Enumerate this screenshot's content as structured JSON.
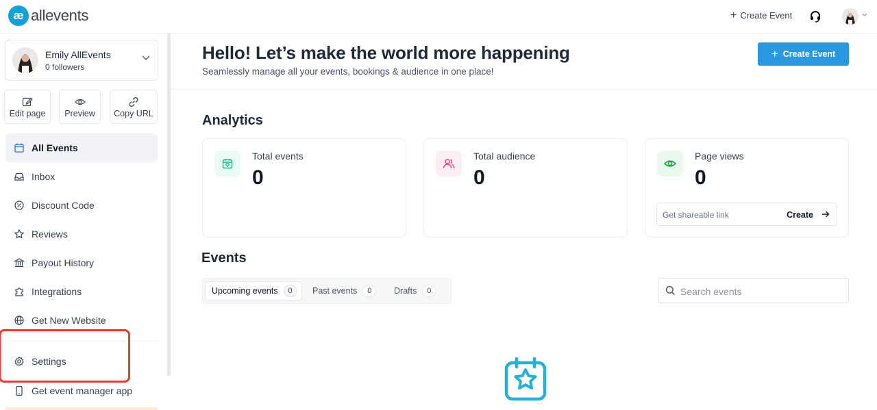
{
  "app": {
    "logo_mark": "æ",
    "logo_text": "allevents"
  },
  "header": {
    "create_event": "Create Event",
    "support_icon": "headset-icon",
    "avatar_icon": "user-avatar"
  },
  "profile": {
    "name": "Emily AllEvents",
    "followers": "0 followers"
  },
  "quick_actions": [
    {
      "label": "Edit page",
      "icon": "edit-icon"
    },
    {
      "label": "Preview",
      "icon": "eye-icon"
    },
    {
      "label": "Copy URL",
      "icon": "link-icon"
    }
  ],
  "sidebar": {
    "items": [
      {
        "label": "All Events",
        "icon": "calendar-icon",
        "active": true
      },
      {
        "label": "Inbox",
        "icon": "inbox-icon"
      },
      {
        "label": "Discount Code",
        "icon": "discount-icon"
      },
      {
        "label": "Reviews",
        "icon": "star-icon"
      },
      {
        "label": "Payout History",
        "icon": "bank-icon"
      },
      {
        "label": "Integrations",
        "icon": "puzzle-icon"
      },
      {
        "label": "Get New Website",
        "icon": "globe-icon"
      }
    ],
    "settings": {
      "label": "Settings",
      "icon": "gear-icon"
    },
    "app_link": {
      "label": "Get event manager app",
      "icon": "phone-icon"
    }
  },
  "main": {
    "title": "Hello! Let’s make the world more happening",
    "subtitle": "Seamlessly manage all your events, bookings & audience in one place!",
    "create_button": "Create Event",
    "analytics": {
      "title": "Analytics",
      "cards": [
        {
          "label": "Total events",
          "value": "0",
          "icon": "calendar-heart-icon",
          "color": "#10b981",
          "bg": "#eafaf4"
        },
        {
          "label": "Total audience",
          "value": "0",
          "icon": "users-icon",
          "color": "#e0457b",
          "bg": "#fdeef3"
        },
        {
          "label": "Page views",
          "value": "0",
          "icon": "eye-icon",
          "color": "#16a34a",
          "bg": "#ebf8ee"
        }
      ],
      "share": {
        "placeholder": "Get shareable link",
        "action": "Create"
      }
    },
    "events": {
      "title": "Events",
      "tabs": [
        {
          "label": "Upcoming events",
          "count": "0",
          "active": true
        },
        {
          "label": "Past events",
          "count": "0"
        },
        {
          "label": "Drafts",
          "count": "0"
        }
      ],
      "search_placeholder": "Search events"
    }
  },
  "colors": {
    "primary": "#2a97e0",
    "highlight": "#f2362c",
    "empty_icon": "#26b0d6"
  }
}
